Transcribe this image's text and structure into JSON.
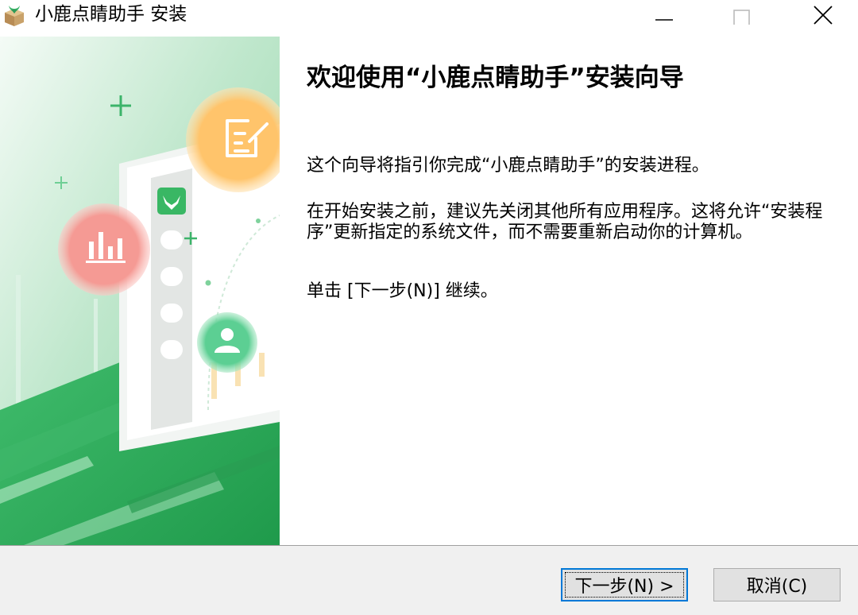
{
  "window": {
    "title": "小鹿点睛助手 安装"
  },
  "content": {
    "heading": "欢迎使用“小鹿点睛助手”安装向导",
    "paragraph1": "这个向导将指引你完成“小鹿点睛助手”的安装进程。",
    "paragraph2": "在开始安装之前，建议先关闭其他所有应用程序。这将允许“安装程序”更新指定的系统文件，而不需要重新启动你的计算机。",
    "paragraph3": "单击 [下一步(N)] 继续。"
  },
  "buttons": {
    "next": "下一步(N) >",
    "cancel": "取消(C)"
  },
  "colors": {
    "banner_green": "#3cb46a",
    "banner_dark_green": "#1f9a4b",
    "note_circle": "#ffc46b",
    "chart_circle": "#f59a94",
    "user_circle": "#4fc98a",
    "accent": "#0078d7"
  },
  "icons": {
    "app": "deer-box-icon",
    "minimize": "minimize-icon",
    "maximize": "maximize-icon",
    "close": "close-icon",
    "note": "edit-note-icon",
    "chart": "bar-chart-icon",
    "user": "user-icon",
    "deer_logo": "deer-logo-icon"
  }
}
